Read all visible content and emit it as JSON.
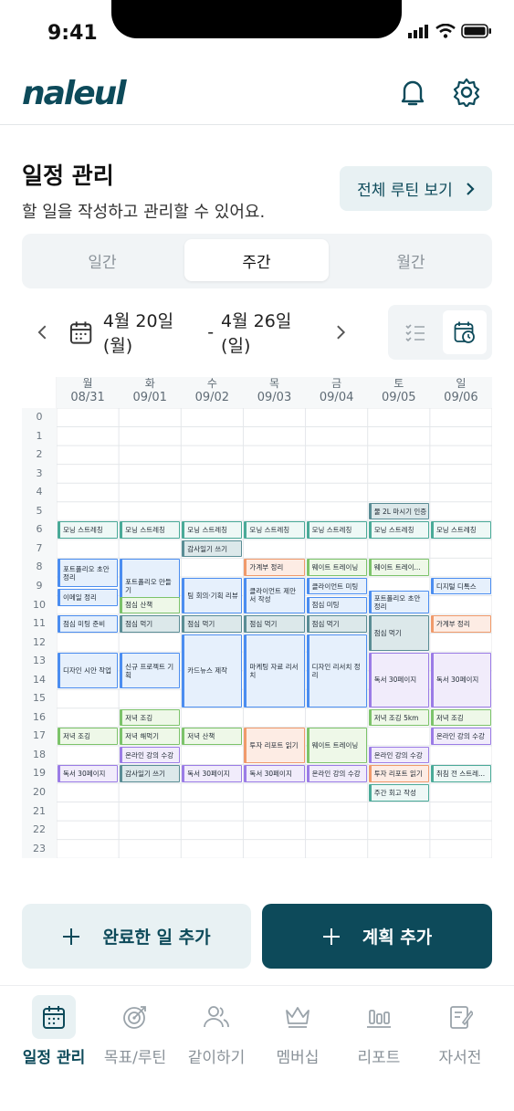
{
  "status_bar": {
    "time": "9:41"
  },
  "header": {
    "logo": "naleul"
  },
  "page": {
    "title": "일정 관리",
    "subtitle": "할 일을 작성하고 관리할 수 있어요.",
    "routine_button": "전체 루틴 보기"
  },
  "segments": [
    "일간",
    "주간",
    "월간"
  ],
  "active_segment": "주간",
  "date_range": {
    "start": "4월 20일(월)",
    "separator": "-",
    "end": "4월 26일(일)"
  },
  "days": [
    {
      "name": "월",
      "date": "08/31"
    },
    {
      "name": "화",
      "date": "09/01"
    },
    {
      "name": "수",
      "date": "09/02"
    },
    {
      "name": "목",
      "date": "09/03"
    },
    {
      "name": "금",
      "date": "09/04"
    },
    {
      "name": "토",
      "date": "09/05"
    },
    {
      "name": "일",
      "date": "09/06"
    }
  ],
  "hours": [
    "0",
    "1",
    "2",
    "3",
    "4",
    "5",
    "6",
    "7",
    "8",
    "9",
    "10",
    "11",
    "12",
    "13",
    "14",
    "15",
    "16",
    "17",
    "18",
    "19",
    "20",
    "21",
    "22",
    "23"
  ],
  "colors": {
    "teal": "#4aaa98",
    "blue": "#4b8df0",
    "green": "#7cc36a",
    "orange": "#f09a6b",
    "purple": "#9b7ce6",
    "slate": "#5a8d95",
    "brand": "#0d4a5a"
  },
  "events": [
    {
      "day": 5,
      "start": 5,
      "end": 6,
      "title": "물 2L 마시기 인증",
      "color": "slate"
    },
    {
      "day": 0,
      "start": 6,
      "end": 7,
      "title": "모닝 스트레칭",
      "color": "teal"
    },
    {
      "day": 1,
      "start": 6,
      "end": 7,
      "title": "모닝 스트레칭",
      "color": "teal"
    },
    {
      "day": 2,
      "start": 6,
      "end": 7,
      "title": "모닝 스트레칭",
      "color": "teal"
    },
    {
      "day": 3,
      "start": 6,
      "end": 7,
      "title": "모닝 스트레칭",
      "color": "teal"
    },
    {
      "day": 4,
      "start": 6,
      "end": 7,
      "title": "모닝 스트레칭",
      "color": "teal"
    },
    {
      "day": 5,
      "start": 6,
      "end": 7,
      "title": "모닝 스트레칭",
      "color": "teal"
    },
    {
      "day": 6,
      "start": 6,
      "end": 7,
      "title": "모닝 스트레칭",
      "color": "teal"
    },
    {
      "day": 2,
      "start": 7,
      "end": 8,
      "title": "감사일기 쓰기",
      "color": "slate"
    },
    {
      "day": 3,
      "start": 8,
      "end": 9,
      "title": "가계부 정리",
      "color": "orange"
    },
    {
      "day": 4,
      "start": 8,
      "end": 9,
      "title": "웨이트 트레이닝",
      "color": "green"
    },
    {
      "day": 5,
      "start": 8,
      "end": 9,
      "title": "웨이트 트레이...",
      "color": "green"
    },
    {
      "day": 0,
      "start": 8,
      "end": 9.6,
      "title": "포트폴리오 초안 정리",
      "color": "blue"
    },
    {
      "day": 0,
      "start": 9.6,
      "end": 10.6,
      "title": "이메일 정리",
      "color": "blue"
    },
    {
      "day": 1,
      "start": 8,
      "end": 11,
      "title": "포트폴리오 만들기",
      "color": "blue"
    },
    {
      "day": 2,
      "start": 9,
      "end": 11,
      "title": "팀 회의·기획 리뷰",
      "color": "blue"
    },
    {
      "day": 3,
      "start": 9,
      "end": 11,
      "title": "클라이언트 제안서 작성",
      "color": "blue"
    },
    {
      "day": 4,
      "start": 9,
      "end": 10,
      "title": "클라이언트 미팅",
      "color": "blue"
    },
    {
      "day": 4,
      "start": 10,
      "end": 11,
      "title": "점심 미팅",
      "color": "blue"
    },
    {
      "day": 5,
      "start": 9.7,
      "end": 11,
      "title": "포트폴리오 초안 정리",
      "color": "blue"
    },
    {
      "day": 6,
      "start": 9,
      "end": 10,
      "title": "디지털 디톡스",
      "color": "blue"
    },
    {
      "day": 1,
      "start": 10,
      "end": 11,
      "title": "점심 산책",
      "color": "green"
    },
    {
      "day": 0,
      "start": 11,
      "end": 12,
      "title": "점심 미팅 준비",
      "color": "blue"
    },
    {
      "day": 1,
      "start": 11,
      "end": 12,
      "title": "점심 먹기",
      "color": "slate"
    },
    {
      "day": 2,
      "start": 11,
      "end": 12,
      "title": "점심 먹기",
      "color": "slate"
    },
    {
      "day": 3,
      "start": 11,
      "end": 12,
      "title": "점심 먹기",
      "color": "slate"
    },
    {
      "day": 4,
      "start": 11,
      "end": 12,
      "title": "점심 먹기",
      "color": "slate"
    },
    {
      "day": 5,
      "start": 11,
      "end": 13,
      "title": "점심 먹기",
      "color": "slate"
    },
    {
      "day": 6,
      "start": 11,
      "end": 12,
      "title": "가계부 정리",
      "color": "orange"
    },
    {
      "day": 0,
      "start": 13,
      "end": 15,
      "title": "디자인 시안 작업",
      "color": "blue"
    },
    {
      "day": 1,
      "start": 13,
      "end": 15,
      "title": "신규 프로젝트 기획",
      "color": "blue"
    },
    {
      "day": 2,
      "start": 12,
      "end": 16,
      "title": "카드뉴스 제작",
      "color": "blue"
    },
    {
      "day": 3,
      "start": 12,
      "end": 16,
      "title": "마케팅 자료 리서치",
      "color": "blue"
    },
    {
      "day": 4,
      "start": 12,
      "end": 16,
      "title": "디자인 리서치 정리",
      "color": "blue"
    },
    {
      "day": 5,
      "start": 13,
      "end": 16,
      "title": "독서 30페이지",
      "color": "purple"
    },
    {
      "day": 6,
      "start": 13,
      "end": 16,
      "title": "독서 30페이지",
      "color": "purple"
    },
    {
      "day": 1,
      "start": 16,
      "end": 17,
      "title": "저녁 조깅",
      "color": "green"
    },
    {
      "day": 5,
      "start": 16,
      "end": 17,
      "title": "저녁 조깅 5km",
      "color": "green"
    },
    {
      "day": 6,
      "start": 16,
      "end": 17,
      "title": "저녁 조깅",
      "color": "green"
    },
    {
      "day": 0,
      "start": 17,
      "end": 18,
      "title": "저녁 조깅",
      "color": "green"
    },
    {
      "day": 1,
      "start": 17,
      "end": 18,
      "title": "저녁 해먹기",
      "color": "green"
    },
    {
      "day": 2,
      "start": 17,
      "end": 18,
      "title": "저녁 산책",
      "color": "green"
    },
    {
      "day": 3,
      "start": 17,
      "end": 19,
      "title": "투자 리포트 읽기",
      "color": "orange"
    },
    {
      "day": 4,
      "start": 17,
      "end": 19,
      "title": "웨이트 트레이닝",
      "color": "green"
    },
    {
      "day": 6,
      "start": 17,
      "end": 18,
      "title": "온라인 강의 수강",
      "color": "purple"
    },
    {
      "day": 1,
      "start": 18,
      "end": 19,
      "title": "온라인 강의 수강",
      "color": "purple"
    },
    {
      "day": 5,
      "start": 18,
      "end": 19,
      "title": "온라인 강의 수강",
      "color": "purple"
    },
    {
      "day": 0,
      "start": 19,
      "end": 20,
      "title": "독서 30페이지",
      "color": "purple"
    },
    {
      "day": 1,
      "start": 19,
      "end": 20,
      "title": "감사일기 쓰기",
      "color": "slate"
    },
    {
      "day": 2,
      "start": 19,
      "end": 20,
      "title": "독서 30페이지",
      "color": "purple"
    },
    {
      "day": 3,
      "start": 19,
      "end": 20,
      "title": "독서 30페이지",
      "color": "purple"
    },
    {
      "day": 4,
      "start": 19,
      "end": 20,
      "title": "온라인 강의 수강",
      "color": "purple"
    },
    {
      "day": 5,
      "start": 19,
      "end": 20,
      "title": "투자 리포트 읽기",
      "color": "orange"
    },
    {
      "day": 6,
      "start": 19,
      "end": 20,
      "title": "취침 전 스트레...",
      "color": "teal"
    },
    {
      "day": 5,
      "start": 20,
      "end": 21,
      "title": "주간 회고 작성",
      "color": "teal"
    }
  ],
  "actions": {
    "done_label": "완료한 일 추가",
    "plan_label": "계획 추가"
  },
  "tabs": [
    {
      "label": "일정 관리",
      "icon": "calendar-icon"
    },
    {
      "label": "목표/루틴",
      "icon": "target-icon"
    },
    {
      "label": "같이하기",
      "icon": "people-icon"
    },
    {
      "label": "멤버십",
      "icon": "crown-icon"
    },
    {
      "label": "리포트",
      "icon": "report-icon"
    },
    {
      "label": "자서전",
      "icon": "journal-icon"
    }
  ],
  "active_tab": "일정 관리"
}
